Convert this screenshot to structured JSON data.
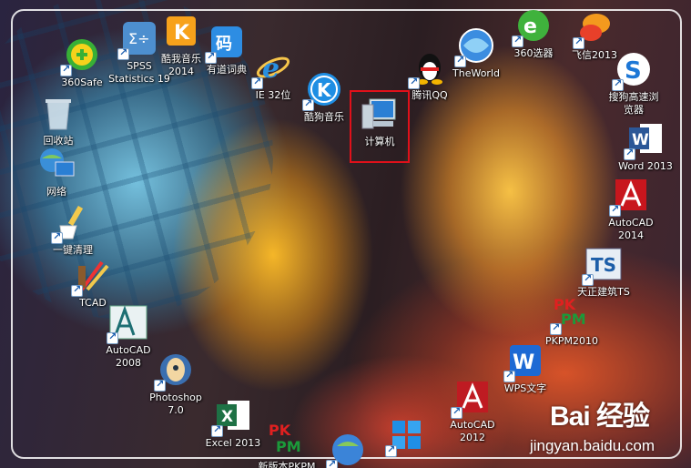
{
  "desktop": {
    "icons": [
      {
        "label": "360Safe",
        "icon": "360safe-icon"
      },
      {
        "label": "SPSS\nStatistics 19",
        "icon": "spss-icon"
      },
      {
        "label": "酷我音乐\n2014",
        "icon": "kuwo-music-icon"
      },
      {
        "label": "有道词典",
        "icon": "youdao-dict-icon"
      },
      {
        "label": "IE 32位",
        "icon": "ie-icon"
      },
      {
        "label": "酷狗音乐",
        "icon": "kugou-music-icon"
      },
      {
        "label": "计算机",
        "icon": "computer-icon"
      },
      {
        "label": "腾讯QQ",
        "icon": "qq-icon"
      },
      {
        "label": "TheWorld",
        "icon": "theworld-browser-icon"
      },
      {
        "label": "360选器",
        "icon": "360-browser-icon"
      },
      {
        "label": "飞信2013",
        "icon": "fetion-icon"
      },
      {
        "label": "搜狗高速浏\n览器",
        "icon": "sogou-browser-icon"
      },
      {
        "label": "回收站",
        "icon": "recycle-bin-icon"
      },
      {
        "label": "网络",
        "icon": "network-icon"
      },
      {
        "label": "Word 2013",
        "icon": "word-icon"
      },
      {
        "label": "一键清理",
        "icon": "cleanup-icon"
      },
      {
        "label": "AutoCAD\n2014",
        "icon": "autocad-2014-icon"
      },
      {
        "label": "TCAD",
        "icon": "tcad-icon"
      },
      {
        "label": "天正建筑TS",
        "icon": "tangent-ts-icon"
      },
      {
        "label": "AutoCAD\n2008",
        "icon": "autocad-2008-icon"
      },
      {
        "label": "PKPM2010",
        "icon": "pkpm2010-icon"
      },
      {
        "label": "Photoshop\n7.0",
        "icon": "photoshop-icon"
      },
      {
        "label": "WPS文字",
        "icon": "wps-icon"
      },
      {
        "label": "Excel 2013",
        "icon": "excel-icon"
      },
      {
        "label": "AutoCAD\n2012",
        "icon": "autocad-2012-icon"
      },
      {
        "label": "新版本PKPM",
        "icon": "pkpm-new-icon"
      },
      {
        "label": "",
        "icon": "globe-icon"
      },
      {
        "label": "",
        "icon": "metro-tiles-icon"
      }
    ]
  },
  "watermark": {
    "logo_text": "Bai 经验",
    "url": "jingyan.baidu.com"
  },
  "colors": {
    "selection": "#e0101a",
    "label_text": "#ffffff"
  }
}
